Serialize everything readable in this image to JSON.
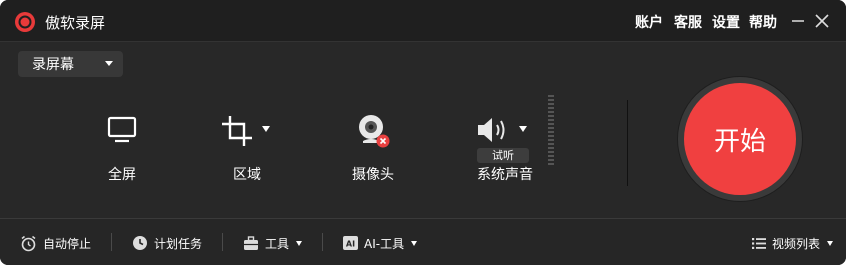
{
  "app": {
    "title": "傲软录屏"
  },
  "menu": {
    "account": "账户",
    "support": "客服",
    "settings": "设置",
    "help": "帮助"
  },
  "mode_select": {
    "value": "录屏幕"
  },
  "tools": {
    "fullscreen": "全屏",
    "region": "区域",
    "webcam": "摄像头",
    "system_audio": "系统声音",
    "audition": "试听"
  },
  "start_button": {
    "label": "开始"
  },
  "bottom": {
    "auto_stop": "自动停止",
    "schedule": "计划任务",
    "tools": "工具",
    "ai_tools": "AI-工具",
    "video_list": "视频列表"
  },
  "colors": {
    "accent": "#f04040",
    "background": "#282828",
    "titlebar": "#1f1f1f"
  },
  "icons": [
    "record-logo-icon",
    "minimize-icon",
    "close-icon",
    "monitor-icon",
    "crop-icon",
    "webcam-icon",
    "speaker-icon",
    "alarm-clock-icon",
    "clock-icon",
    "toolbox-icon",
    "ai-icon",
    "list-icon"
  ]
}
